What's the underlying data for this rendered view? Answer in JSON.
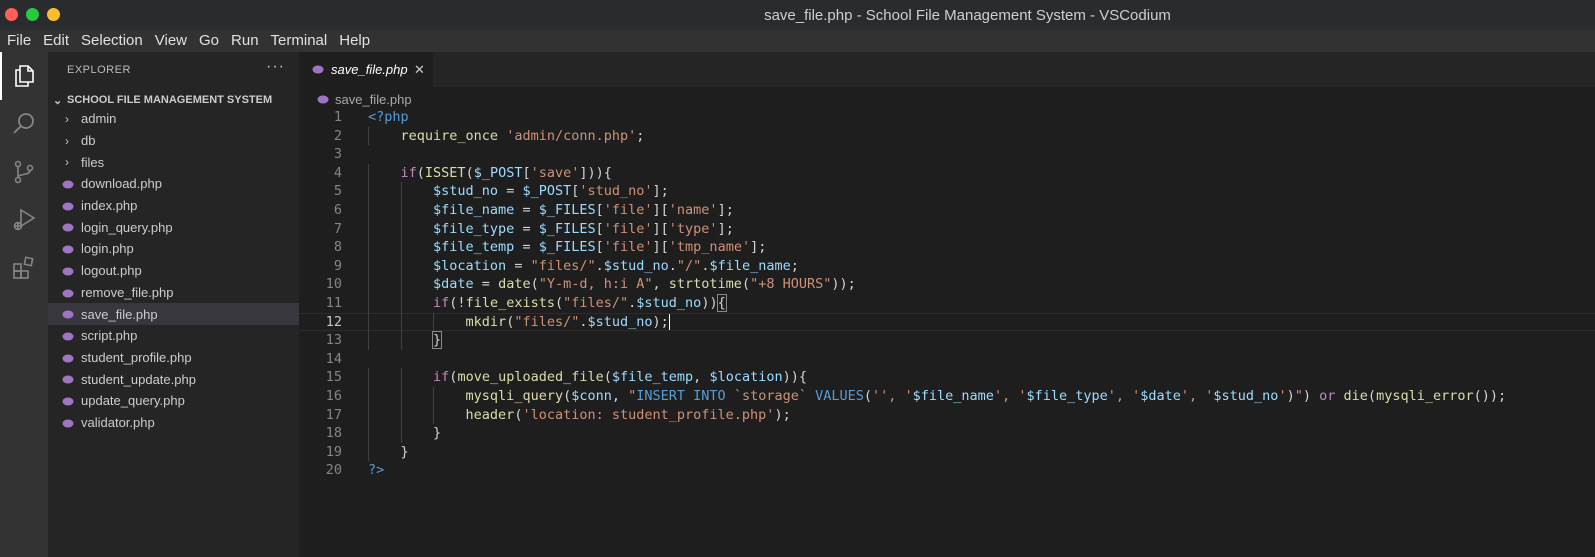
{
  "window": {
    "title": "save_file.php - School File Management System - VSCodium"
  },
  "menu": [
    "File",
    "Edit",
    "Selection",
    "View",
    "Go",
    "Run",
    "Terminal",
    "Help"
  ],
  "activity_bar": [
    "explorer-icon",
    "search-icon",
    "source-control-icon",
    "run-debug-icon",
    "extensions-icon"
  ],
  "explorer": {
    "header": "EXPLORER",
    "more": "···",
    "root": "SCHOOL FILE MANAGEMENT SYSTEM",
    "folders": [
      "admin",
      "db",
      "files"
    ],
    "files": [
      "download.php",
      "index.php",
      "login_query.php",
      "login.php",
      "logout.php",
      "remove_file.php",
      "save_file.php",
      "script.php",
      "student_profile.php",
      "student_update.php",
      "update_query.php",
      "validator.php"
    ],
    "selected": "save_file.php"
  },
  "editor": {
    "tab_label": "save_file.php",
    "tab_close": "✕",
    "breadcrumb": "save_file.php",
    "current_line": 12,
    "colors": {
      "keyword": "#569cd6",
      "control": "#c586c0",
      "function": "#dcdcaa",
      "variable": "#9cdcfe",
      "string": "#ce9178"
    }
  },
  "code_lines": [
    [
      [
        "kw",
        "<?php"
      ]
    ],
    [
      [
        "txt",
        "    "
      ],
      [
        "fn",
        "require_once"
      ],
      [
        "txt",
        " "
      ],
      [
        "str",
        "'admin/conn.php'"
      ],
      [
        "txt",
        ";"
      ]
    ],
    [],
    [
      [
        "txt",
        "    "
      ],
      [
        "ctl",
        "if"
      ],
      [
        "txt",
        "("
      ],
      [
        "fn",
        "ISSET"
      ],
      [
        "txt",
        "("
      ],
      [
        "var",
        "$_POST"
      ],
      [
        "txt",
        "["
      ],
      [
        "str",
        "'save'"
      ],
      [
        "txt",
        "])){"
      ]
    ],
    [
      [
        "txt",
        "        "
      ],
      [
        "var",
        "$stud_no"
      ],
      [
        "txt",
        " = "
      ],
      [
        "var",
        "$_POST"
      ],
      [
        "txt",
        "["
      ],
      [
        "str",
        "'stud_no'"
      ],
      [
        "txt",
        "];"
      ]
    ],
    [
      [
        "txt",
        "        "
      ],
      [
        "var",
        "$file_name"
      ],
      [
        "txt",
        " = "
      ],
      [
        "var",
        "$_FILES"
      ],
      [
        "txt",
        "["
      ],
      [
        "str",
        "'file'"
      ],
      [
        "txt",
        "]["
      ],
      [
        "str",
        "'name'"
      ],
      [
        "txt",
        "];"
      ]
    ],
    [
      [
        "txt",
        "        "
      ],
      [
        "var",
        "$file_type"
      ],
      [
        "txt",
        " = "
      ],
      [
        "var",
        "$_FILES"
      ],
      [
        "txt",
        "["
      ],
      [
        "str",
        "'file'"
      ],
      [
        "txt",
        "]["
      ],
      [
        "str",
        "'type'"
      ],
      [
        "txt",
        "];"
      ]
    ],
    [
      [
        "txt",
        "        "
      ],
      [
        "var",
        "$file_temp"
      ],
      [
        "txt",
        " = "
      ],
      [
        "var",
        "$_FILES"
      ],
      [
        "txt",
        "["
      ],
      [
        "str",
        "'file'"
      ],
      [
        "txt",
        "]["
      ],
      [
        "str",
        "'tmp_name'"
      ],
      [
        "txt",
        "];"
      ]
    ],
    [
      [
        "txt",
        "        "
      ],
      [
        "var",
        "$location"
      ],
      [
        "txt",
        " = "
      ],
      [
        "str",
        "\"files/\""
      ],
      [
        "txt",
        "."
      ],
      [
        "var",
        "$stud_no"
      ],
      [
        "txt",
        "."
      ],
      [
        "str",
        "\"/\""
      ],
      [
        "txt",
        "."
      ],
      [
        "var",
        "$file_name"
      ],
      [
        "txt",
        ";"
      ]
    ],
    [
      [
        "txt",
        "        "
      ],
      [
        "var",
        "$date"
      ],
      [
        "txt",
        " = "
      ],
      [
        "fn",
        "date"
      ],
      [
        "txt",
        "("
      ],
      [
        "str",
        "\"Y-m-d, h:i A\""
      ],
      [
        "txt",
        ", "
      ],
      [
        "fn",
        "strtotime"
      ],
      [
        "txt",
        "("
      ],
      [
        "str",
        "\"+8 HOURS\""
      ],
      [
        "txt",
        "));"
      ]
    ],
    [
      [
        "txt",
        "        "
      ],
      [
        "ctl",
        "if"
      ],
      [
        "txt",
        "(!"
      ],
      [
        "fn",
        "file_exists"
      ],
      [
        "txt",
        "("
      ],
      [
        "str",
        "\"files/\""
      ],
      [
        "txt",
        "."
      ],
      [
        "var",
        "$stud_no"
      ],
      [
        "txt",
        "))"
      ],
      [
        "br",
        "{"
      ]
    ],
    [
      [
        "txt",
        "            "
      ],
      [
        "fn",
        "mkdir"
      ],
      [
        "txt",
        "("
      ],
      [
        "str",
        "\"files/\""
      ],
      [
        "txt",
        "."
      ],
      [
        "var",
        "$stud_no"
      ],
      [
        "txt",
        ");"
      ],
      [
        "cur",
        ""
      ]
    ],
    [
      [
        "txt",
        "        "
      ],
      [
        "br",
        "}"
      ]
    ],
    [],
    [
      [
        "txt",
        "        "
      ],
      [
        "ctl",
        "if"
      ],
      [
        "txt",
        "("
      ],
      [
        "fn",
        "move_uploaded_file"
      ],
      [
        "txt",
        "("
      ],
      [
        "var",
        "$file_temp"
      ],
      [
        "txt",
        ", "
      ],
      [
        "var",
        "$location"
      ],
      [
        "txt",
        ")){"
      ]
    ],
    [
      [
        "txt",
        "            "
      ],
      [
        "fn",
        "mysqli_query"
      ],
      [
        "txt",
        "("
      ],
      [
        "var",
        "$conn"
      ],
      [
        "txt",
        ", "
      ],
      [
        "str",
        "\""
      ],
      [
        "kw",
        "INSERT INTO"
      ],
      [
        "str",
        " `storage` "
      ],
      [
        "kw",
        "VALUES"
      ],
      [
        "txt",
        "("
      ],
      [
        "str",
        "'', '"
      ],
      [
        "var",
        "$file_name"
      ],
      [
        "str",
        "', '"
      ],
      [
        "var",
        "$file_type"
      ],
      [
        "str",
        "', '"
      ],
      [
        "var",
        "$date"
      ],
      [
        "str",
        "', '"
      ],
      [
        "var",
        "$stud_no"
      ],
      [
        "str",
        "'"
      ],
      [
        "txt",
        ")"
      ],
      [
        "str",
        "\""
      ],
      [
        "txt",
        ") "
      ],
      [
        "ctl",
        "or"
      ],
      [
        "txt",
        " "
      ],
      [
        "fn",
        "die"
      ],
      [
        "txt",
        "("
      ],
      [
        "fn",
        "mysqli_error"
      ],
      [
        "txt",
        "());"
      ]
    ],
    [
      [
        "txt",
        "            "
      ],
      [
        "fn",
        "header"
      ],
      [
        "txt",
        "("
      ],
      [
        "str",
        "'location: student_profile.php'"
      ],
      [
        "txt",
        ");"
      ]
    ],
    [
      [
        "txt",
        "        }"
      ]
    ],
    [
      [
        "txt",
        "    }"
      ]
    ],
    [
      [
        "kw",
        "?>"
      ]
    ]
  ]
}
